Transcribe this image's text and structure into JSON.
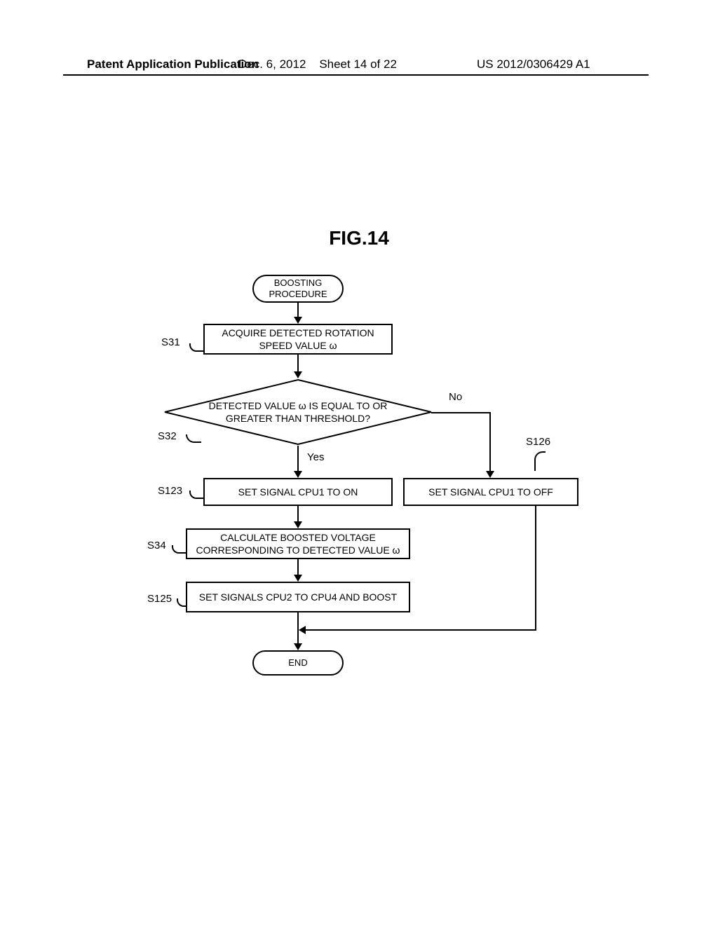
{
  "header": {
    "left": "Patent Application Publication",
    "date": "Dec. 6, 2012",
    "sheet": "Sheet 14 of 22",
    "pubno": "US 2012/0306429 A1"
  },
  "figure": {
    "title": "FIG.14"
  },
  "flow": {
    "start": "BOOSTING PROCEDURE",
    "s31": {
      "ref": "S31",
      "text": "ACQUIRE DETECTED ROTATION SPEED VALUE ω"
    },
    "s32": {
      "ref": "S32",
      "text": "DETECTED VALUE ω IS EQUAL TO OR GREATER THAN THRESHOLD?",
      "yes": "Yes",
      "no": "No"
    },
    "s123": {
      "ref": "S123",
      "text": "SET SIGNAL CPU1 TO ON"
    },
    "s126": {
      "ref": "S126",
      "text": "SET SIGNAL CPU1 TO OFF"
    },
    "s34": {
      "ref": "S34",
      "text": "CALCULATE BOOSTED VOLTAGE CORRESPONDING TO DETECTED VALUE ω"
    },
    "s125": {
      "ref": "S125",
      "text": "SET SIGNALS CPU2 TO CPU4 AND BOOST"
    },
    "end": "END"
  }
}
